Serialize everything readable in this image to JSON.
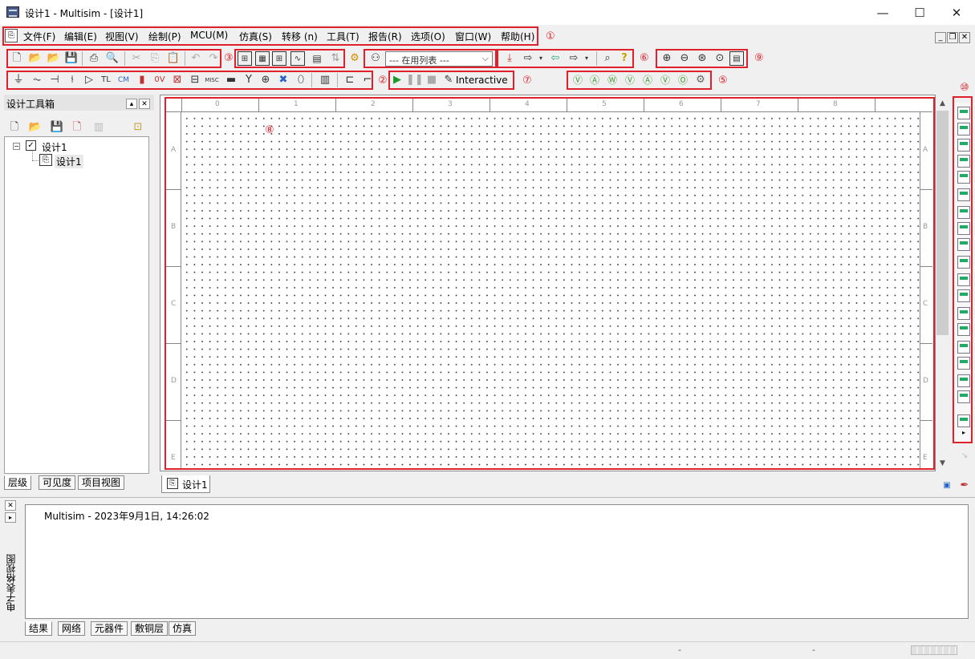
{
  "window": {
    "title": "设计1 - Multisim - [设计1]",
    "minimize": "—",
    "maximize": "☐",
    "close": "✕"
  },
  "menu": {
    "items": [
      "文件(F)",
      "编辑(E)",
      "视图(V)",
      "绘制(P)",
      "MCU(M)",
      "仿真(S)",
      "转移 (n)",
      "工具(T)",
      "报告(R)",
      "选项(O)",
      "窗口(W)",
      "帮助(H)"
    ],
    "mdi_min": "_",
    "mdi_restore": "❐",
    "mdi_close": "✕"
  },
  "callouts": [
    "①",
    "②",
    "③",
    "⑤",
    "⑥",
    "⑦",
    "⑧",
    "⑨",
    "⑩"
  ],
  "toolbar": {
    "in_use_list": "--- 在用列表 ---",
    "interactive_label": "Interactive",
    "misc_label": "MISC"
  },
  "left_panel": {
    "title": "设计工具箱",
    "tree_root": "设计1",
    "tree_child": "设计1",
    "tabs": [
      "层级",
      "可见度",
      "项目视图"
    ]
  },
  "canvas": {
    "col_labels": [
      "0",
      "1",
      "2",
      "3",
      "4",
      "5",
      "6",
      "7",
      "8"
    ],
    "row_labels": [
      "A",
      "B",
      "C",
      "D",
      "E"
    ],
    "tab_label": "设计1"
  },
  "bottom": {
    "side_label": "电子表格视图",
    "log_line": "Multisim  -  2023年9月1日, 14:26:02",
    "tabs": [
      "结果",
      "网络",
      "元器件",
      "敷铜层",
      "仿真"
    ]
  },
  "status": {
    "left_dash": "-",
    "right_dash": "-"
  }
}
